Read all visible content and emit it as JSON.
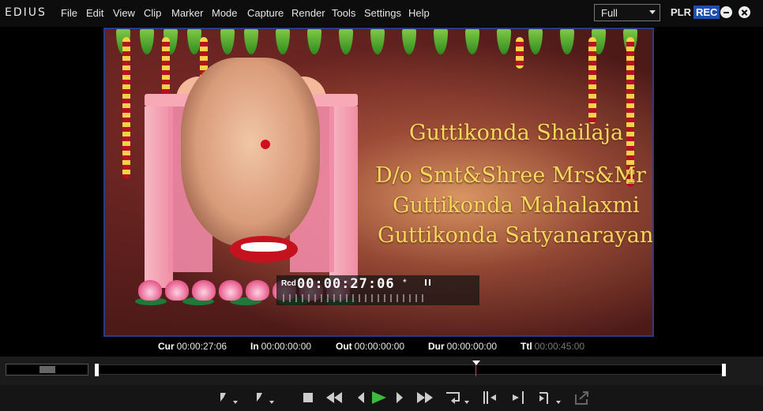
{
  "app": {
    "logo": "EDIUS"
  },
  "menu": [
    "File",
    "Edit",
    "View",
    "Clip",
    "Marker",
    "Mode",
    "Capture",
    "Render",
    "Tools",
    "Settings",
    "Help"
  ],
  "mode_select": {
    "value": "Full"
  },
  "status": {
    "plr": "PLR",
    "rec": "REC"
  },
  "preview": {
    "lines": [
      "Guttikonda Shailaja",
      "D/o Smt&Shree Mrs&Mr",
      "Guttikonda Mahalaxmi",
      "Guttikonda Satyanarayana"
    ]
  },
  "overlay": {
    "rcd": "Rcd",
    "timecode": "00:00:27:06",
    "star": "*"
  },
  "timecodes": [
    {
      "label": "Cur",
      "value": "00:00:27:06"
    },
    {
      "label": "In",
      "value": "00:00:00:00"
    },
    {
      "label": "Out",
      "value": "00:00:00:00"
    },
    {
      "label": "Dur",
      "value": "00:00:00:00"
    },
    {
      "label": "Ttl",
      "value": "00:00:45:00"
    }
  ],
  "playback": {
    "position_fraction": 0.6
  },
  "controls": [
    "set-in-icon",
    "set-out-icon",
    "stop-icon",
    "rewind-icon",
    "previous-frame-icon",
    "play-icon",
    "next-frame-icon",
    "fast-forward-icon",
    "loop-icon",
    "insert-to-timeline-icon",
    "overwrite-to-timeline-icon",
    "trim-icon",
    "export-icon"
  ],
  "colors": {
    "accent_rec": "#1f4fae",
    "play_green": "#3dbb3d",
    "title_gold": "#f6d85c"
  }
}
